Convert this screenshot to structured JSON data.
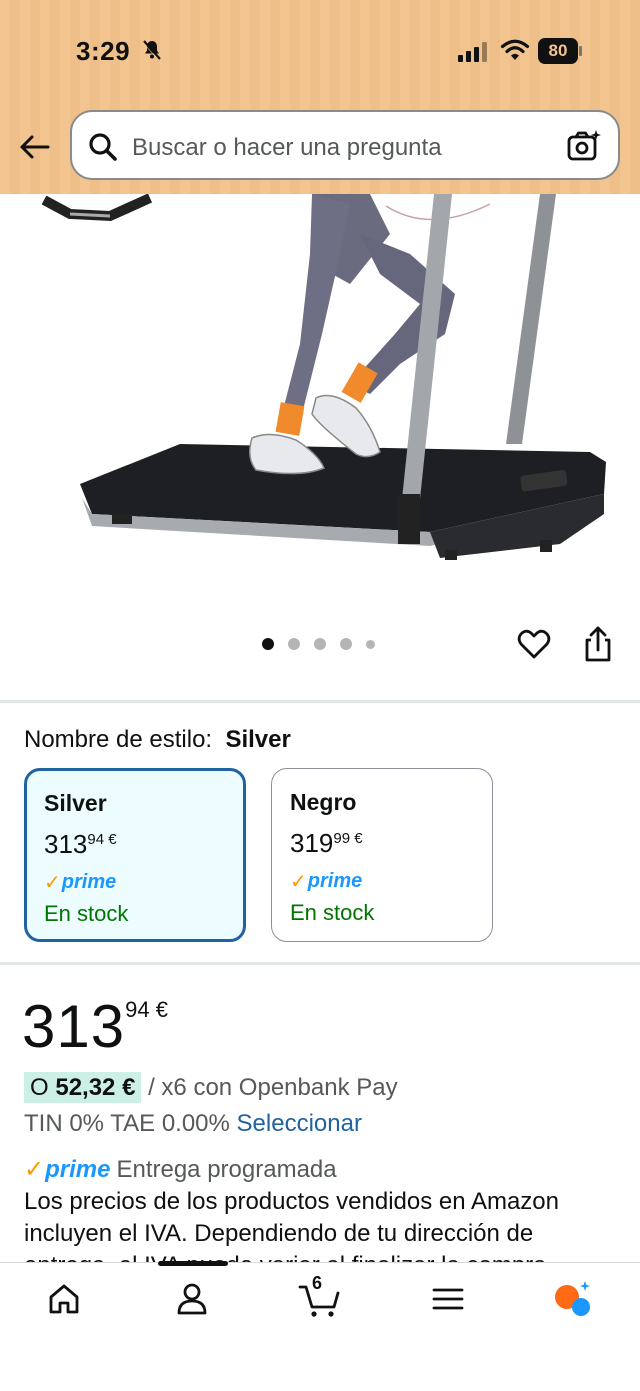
{
  "status_bar": {
    "time": "3:29",
    "battery": "80"
  },
  "search": {
    "placeholder": "Buscar o hacer una pregunta"
  },
  "carousel": {
    "total_dots": 5,
    "active_index": 0
  },
  "style": {
    "label": "Nombre de estilo:",
    "selected": "Silver",
    "variants": [
      {
        "name": "Silver",
        "price_whole": "313",
        "price_fraction": "94 €",
        "prime": "prime",
        "stock": "En stock",
        "selected": true
      },
      {
        "name": "Negro",
        "price_whole": "319",
        "price_fraction": "99 €",
        "prime": "prime",
        "stock": "En stock",
        "selected": false
      }
    ]
  },
  "price": {
    "whole": "313",
    "fraction": "94 €"
  },
  "installment": {
    "prefix": "O",
    "amount": "52,32 €",
    "suffix": "/ x6 con Openbank Pay"
  },
  "tin": {
    "text": "TIN 0% TAE 0.00%",
    "link": "Seleccionar"
  },
  "delivery": {
    "prime": "prime",
    "text": "Entrega programada"
  },
  "vat_text": "Los precios de los productos vendidos en Amazon incluyen el IVA. Dependiendo de tu dirección de entrega, el IVA puede variar al finalizar la compra.",
  "bottom_nav": {
    "cart_count": "6"
  },
  "colors": {
    "header_bg": "#f2c48f",
    "link": "#2162a1",
    "prime_blue": "#1a98ff",
    "prime_check": "#ff9900",
    "stock_green": "#007600",
    "selected_border": "#2162a1"
  }
}
